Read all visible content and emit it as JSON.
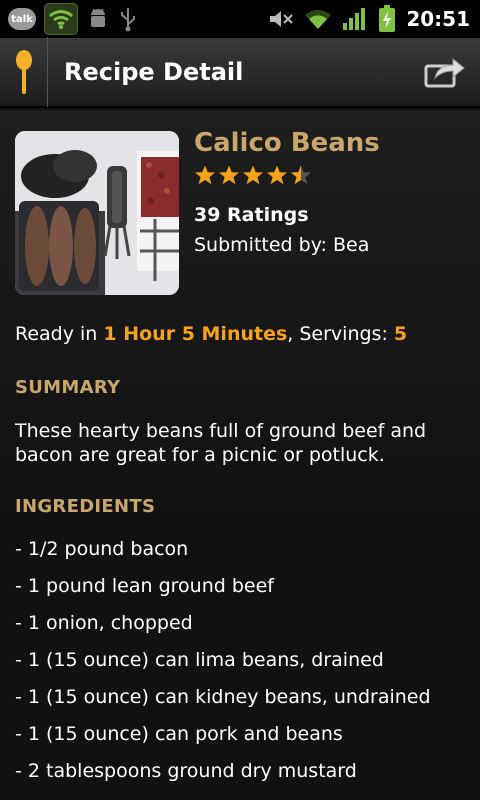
{
  "status": {
    "talk_label": "talk",
    "time": "20:51"
  },
  "header": {
    "title": "Recipe Detail"
  },
  "recipe": {
    "name": "Calico Beans",
    "rating_stars": 4.5,
    "ratings_label": "39 Ratings",
    "submitted_label": "Submitted by: Bea",
    "ready_prefix": "Ready in ",
    "ready_time": "1 Hour 5 Minutes",
    "servings_prefix": ", Servings: ",
    "servings": "5",
    "summary_heading": "SUMMARY",
    "summary_text": "These hearty beans full of ground beef and bacon are great for a picnic or potluck.",
    "ingredients_heading": "INGREDIENTS",
    "ingredients": [
      "- 1/2 pound bacon",
      "- 1 pound lean ground beef",
      "- 1 onion, chopped",
      "- 1 (15 ounce) can lima beans, drained",
      "- 1 (15 ounce) can kidney beans, undrained",
      "- 1 (15 ounce) can pork and beans",
      "- 2 tablespoons ground dry mustard"
    ]
  },
  "colors": {
    "accent_gold": "#c9a66b",
    "highlight_orange": "#f7a21b",
    "star_orange": "#f7a21b"
  },
  "icons": {
    "app": "spoon-icon",
    "share": "share-icon",
    "status": [
      "talk-icon",
      "wifi-icon",
      "android-debug-icon",
      "usb-icon",
      "mute-icon",
      "wifi-signal-icon",
      "cell-signal-icon",
      "battery-charging-icon"
    ]
  }
}
